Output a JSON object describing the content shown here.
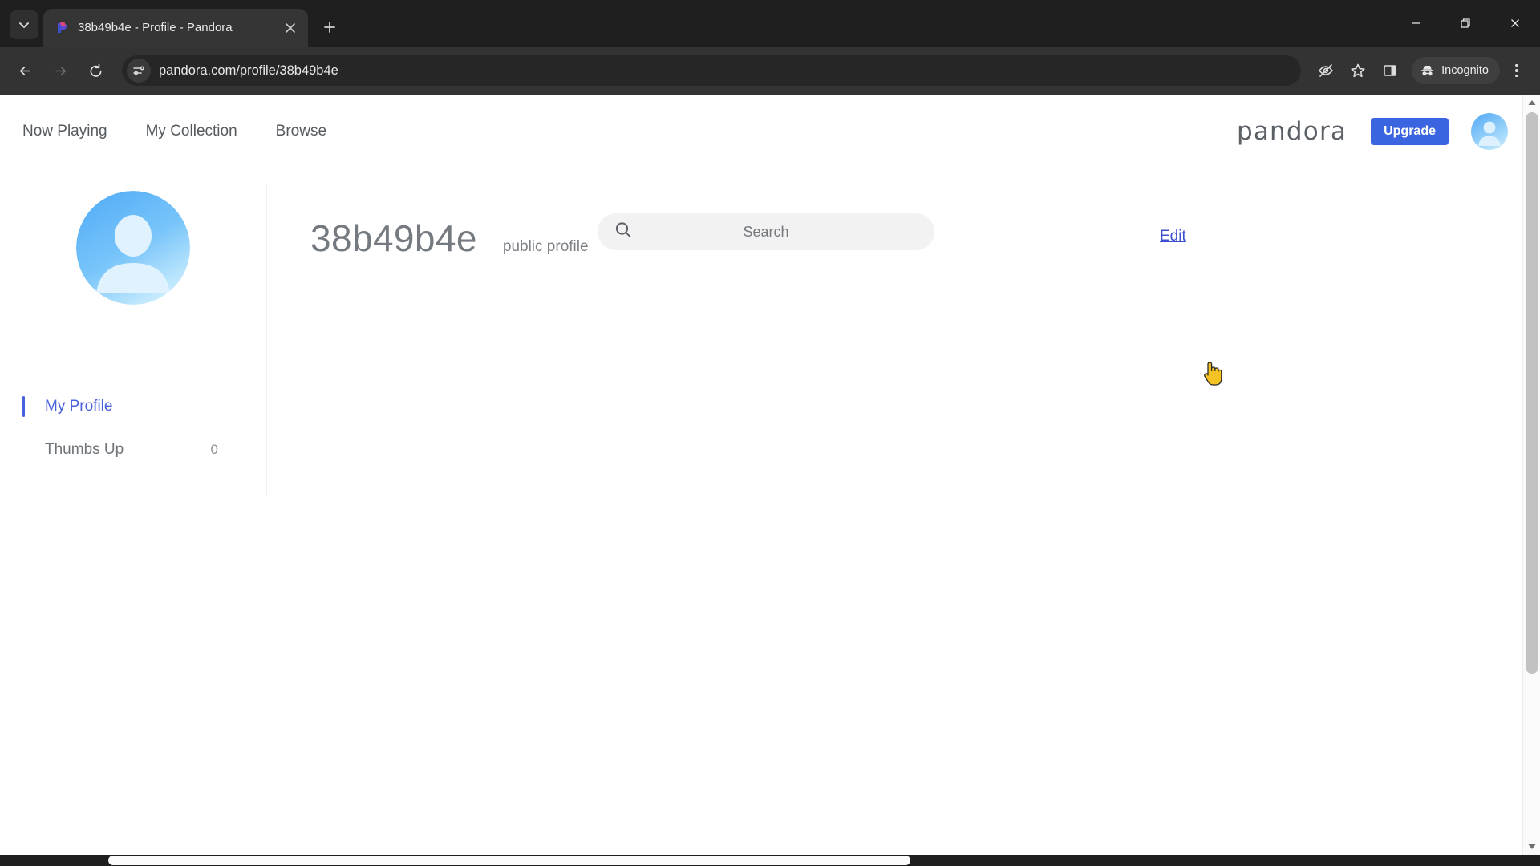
{
  "browser": {
    "tab_search_icon": "chevron-down-icon",
    "tab": {
      "title": "38b49b4e - Profile - Pandora",
      "favicon": "pandora-favicon",
      "close_icon": "close-icon"
    },
    "new_tab_icon": "plus-icon",
    "window_controls": {
      "minimize": "minimize-icon",
      "restore": "restore-icon",
      "close": "close-icon"
    },
    "toolbar": {
      "back_icon": "back-arrow-icon",
      "forward_icon": "forward-arrow-icon",
      "reload_icon": "reload-icon",
      "site_settings_icon": "site-settings-icon",
      "url": "pandora.com/profile/38b49b4e",
      "tracking_protection_icon": "eye-crossed-icon",
      "bookmark_icon": "star-icon",
      "side_panel_icon": "side-panel-icon",
      "incognito_label": "Incognito",
      "incognito_icon": "incognito-hat-icon",
      "menu_icon": "three-dot-menu-icon"
    }
  },
  "page": {
    "nav": [
      {
        "label": "Now Playing"
      },
      {
        "label": "My Collection"
      },
      {
        "label": "Browse"
      }
    ],
    "search": {
      "placeholder": "Search",
      "icon": "search-icon"
    },
    "brand": "pandora",
    "upgrade_label": "Upgrade",
    "account_avatar": "user-avatar",
    "sidebar": {
      "profile_avatar": "profile-avatar",
      "items": [
        {
          "label": "My Profile",
          "count": "",
          "active": true
        },
        {
          "label": "Thumbs Up",
          "count": "0",
          "active": false
        }
      ]
    },
    "profile": {
      "username": "38b49b4e",
      "visibility": "public profile",
      "edit_label": "Edit"
    },
    "scrollbar": {
      "up_arrow_icon": "scroll-up-arrow-icon",
      "down_arrow_icon": "scroll-down-arrow-icon"
    },
    "cursor": "pointing-hand-cursor"
  },
  "colors": {
    "accent_blue": "#3b64e0",
    "sidebar_active": "#4a61dd",
    "link_blue": "#3b4fd0",
    "chrome_dark": "#333333",
    "tabstrip_dark": "#1f1f1f"
  }
}
